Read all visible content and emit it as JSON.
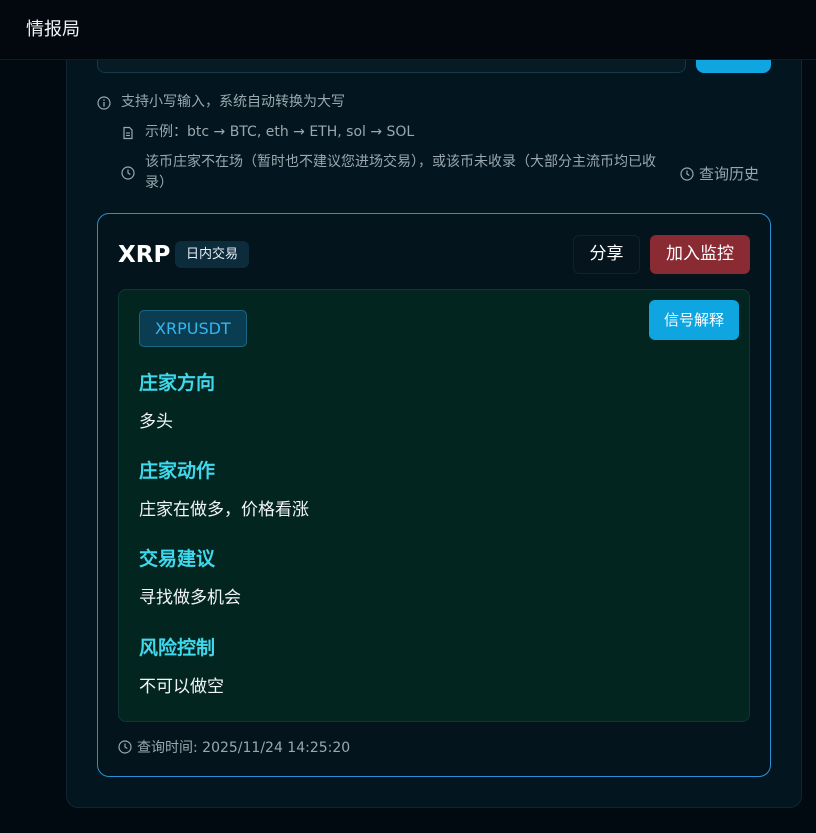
{
  "app": {
    "title": "情报局"
  },
  "hints": {
    "lowercase": "支持小写输入，系统自动转换为大写",
    "example": "示例：btc → BTC, eth → ETH, sol → SOL",
    "not_listed": "该币庄家不在场（暂时也不建议您进场交易），或该币未收录（大部分主流币均已收录）",
    "history_link": "查询历史"
  },
  "result": {
    "coin": "XRP",
    "tag": "日内交易",
    "share_label": "分享",
    "monitor_label": "加入监控",
    "explain_label": "信号解释",
    "symbol": "XRPUSDT",
    "sections": [
      {
        "title": "庄家方向",
        "value": "多头"
      },
      {
        "title": "庄家动作",
        "value": "庄家在做多，价格看涨"
      },
      {
        "title": "交易建议",
        "value": "寻找做多机会"
      },
      {
        "title": "风险控制",
        "value": "不可以做空"
      }
    ],
    "query_time": "查询时间: 2025/11/24 14:25:20"
  },
  "colors": {
    "accent": "#0ea5e0",
    "danger": "#8a2a33",
    "section_title": "#3fd8ec",
    "card_border": "#2b8fd4"
  },
  "icons": {
    "info": "info-icon",
    "doc": "document-icon",
    "clock": "clock-icon"
  }
}
